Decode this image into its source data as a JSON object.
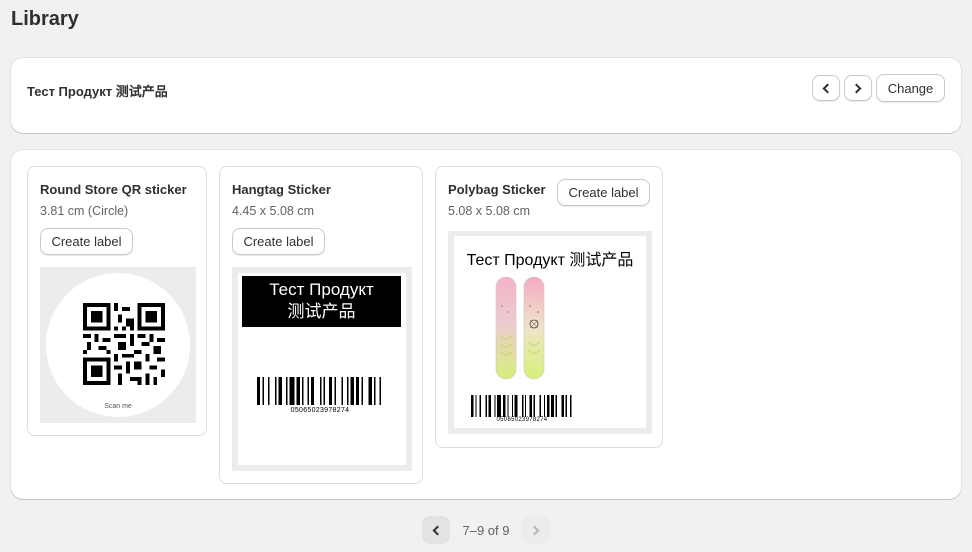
{
  "page": {
    "title": "Library"
  },
  "product": {
    "name": "Тест Продукт 测试产品",
    "prev_icon": "chevron-left-icon",
    "next_icon": "chevron-right-icon",
    "change_label": "Change"
  },
  "labels": [
    {
      "title": "Round Store QR sticker",
      "size": "3.81 cm (Circle)",
      "create_label": "Create label",
      "preview": {
        "caption": "Scan me"
      }
    },
    {
      "title": "Hangtag Sticker",
      "size": "4.45 x 5.08 cm",
      "create_label": "Create label",
      "preview": {
        "heading_line1": "Тест Продукт",
        "heading_line2": "测试产品",
        "barcode_number": "05065023978274"
      }
    },
    {
      "title": "Polybag Sticker",
      "size": "5.08 x 5.08 cm",
      "create_label": "Create label",
      "preview": {
        "heading": "Тест Продукт 测试产品",
        "barcode_number": "05065023978274"
      }
    }
  ],
  "pagination": {
    "label": "7–9 of 9"
  },
  "colors": {
    "page_bg": "#f1f1f1",
    "card_bg": "#ffffff",
    "text": "#303030",
    "muted": "#616161"
  }
}
